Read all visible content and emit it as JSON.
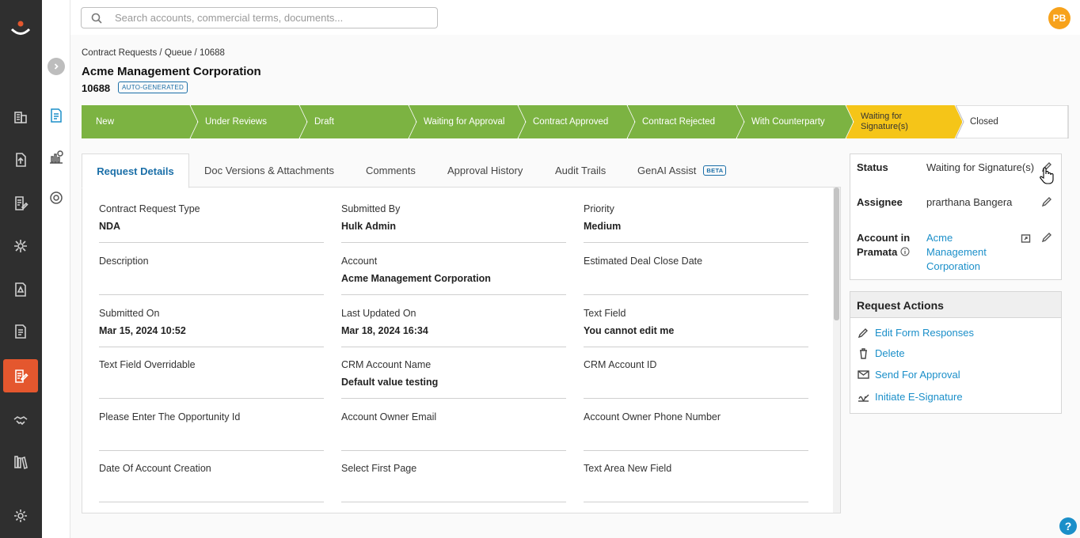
{
  "search": {
    "placeholder": "Search accounts, commercial terms, documents..."
  },
  "user": {
    "initials": "PB"
  },
  "breadcrumb": "Contract Requests / Queue / 10688",
  "page": {
    "title": "Acme Management Corporation",
    "request_id": "10688",
    "badge": "AUTO-GENERATED"
  },
  "stages": [
    {
      "label": "New",
      "state": "done"
    },
    {
      "label": "Under Reviews",
      "state": "done"
    },
    {
      "label": "Draft",
      "state": "done"
    },
    {
      "label": "Waiting for Approval",
      "state": "done"
    },
    {
      "label": "Contract Approved",
      "state": "done"
    },
    {
      "label": "Contract Rejected",
      "state": "done"
    },
    {
      "label": "With Counterparty",
      "state": "done"
    },
    {
      "label": "Waiting for Signature(s)",
      "state": "current"
    },
    {
      "label": "Closed",
      "state": "pending"
    }
  ],
  "colors": {
    "done": "#7cb342",
    "current": "#f5c518",
    "accent": "#1b6fa8",
    "active_nav": "#e4572e"
  },
  "tabs": [
    "Request Details",
    "Doc Versions & Attachments",
    "Comments",
    "Approval History",
    "Audit Trails",
    "GenAI Assist"
  ],
  "tab_beta": "BETA",
  "fields": [
    {
      "label": "Contract Request Type",
      "value": "NDA"
    },
    {
      "label": "Submitted By",
      "value": "Hulk Admin"
    },
    {
      "label": "Priority",
      "value": "Medium"
    },
    {
      "label": "Description",
      "value": ""
    },
    {
      "label": "Account",
      "value": "Acme Management Corporation"
    },
    {
      "label": "Estimated Deal Close Date",
      "value": ""
    },
    {
      "label": "Submitted On",
      "value": "Mar 15, 2024 10:52"
    },
    {
      "label": "Last Updated On",
      "value": "Mar 18, 2024 16:34"
    },
    {
      "label": "Text Field",
      "value": "You cannot edit me"
    },
    {
      "label": "Text Field Overridable",
      "value": ""
    },
    {
      "label": "CRM Account Name",
      "value": "Default value testing"
    },
    {
      "label": "CRM Account ID",
      "value": ""
    },
    {
      "label": "Please Enter The Opportunity Id",
      "value": ""
    },
    {
      "label": "Account Owner Email",
      "value": ""
    },
    {
      "label": "Account Owner Phone Number",
      "value": ""
    },
    {
      "label": "Date Of Account Creation",
      "value": ""
    },
    {
      "label": "Select First Page",
      "value": ""
    },
    {
      "label": "Text Area New Field",
      "value": ""
    }
  ],
  "info": {
    "status_label": "Status",
    "status_value": "Waiting for Signature(s)",
    "assignee_label": "Assignee",
    "assignee_value": "prarthana Bangera",
    "account_label_1": "Account in",
    "account_label_2": "Pramata",
    "account_value_1": "Acme",
    "account_value_2": "Management",
    "account_value_3": "Corporation"
  },
  "actions": {
    "title": "Request Actions",
    "items": [
      "Edit Form Responses",
      "Delete",
      "Send For Approval",
      "Initiate E-Signature"
    ]
  },
  "help": "?"
}
